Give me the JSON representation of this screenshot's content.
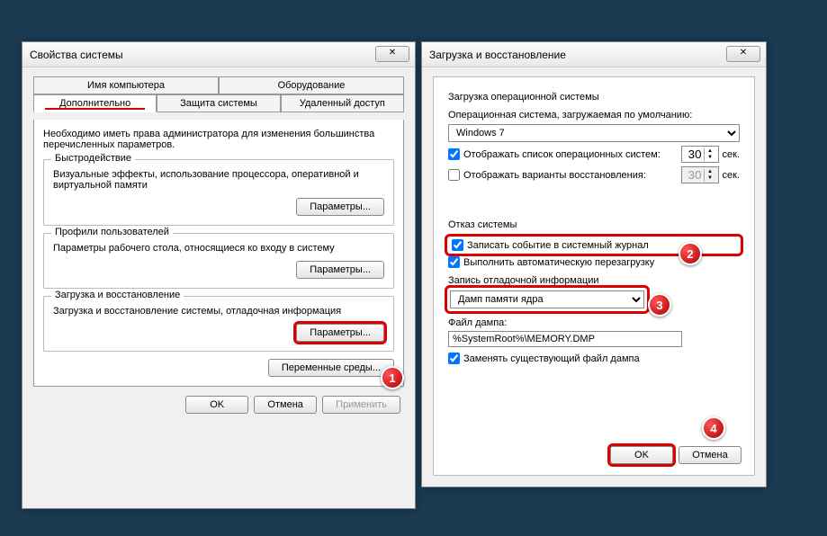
{
  "left": {
    "title": "Свойства системы",
    "tabs_row1": [
      "Имя компьютера",
      "Оборудование"
    ],
    "tabs_row2": [
      "Дополнительно",
      "Защита системы",
      "Удаленный доступ"
    ],
    "intro": "Необходимо иметь права администратора для изменения большинства перечисленных параметров.",
    "group1": {
      "title": "Быстродействие",
      "text": "Визуальные эффекты, использование процессора, оперативной и виртуальной памяти",
      "button": "Параметры..."
    },
    "group2": {
      "title": "Профили пользователей",
      "text": "Параметры рабочего стола, относящиеся ко входу в систему",
      "button": "Параметры..."
    },
    "group3": {
      "title": "Загрузка и восстановление",
      "text": "Загрузка и восстановление системы, отладочная информация",
      "button": "Параметры..."
    },
    "env_button": "Переменные среды...",
    "ok": "OK",
    "cancel": "Отмена",
    "apply": "Применить"
  },
  "right": {
    "title": "Загрузка и восстановление",
    "boot_section": "Загрузка операционной системы",
    "default_os_label": "Операционная система, загружаемая по умолчанию:",
    "default_os_value": "Windows 7",
    "show_os_list": "Отображать список операционных систем:",
    "show_os_time": "30",
    "show_recovery": "Отображать варианты восстановления:",
    "show_recovery_time": "30",
    "sec": "сек.",
    "failure_section": "Отказ системы",
    "log_event": "Записать событие в системный журнал",
    "auto_restart": "Выполнить автоматическую перезагрузку",
    "debug_label": "Запись отладочной информации",
    "dump_type": "Дамп памяти ядра",
    "dump_file_label": "Файл дампа:",
    "dump_file": "%SystemRoot%\\MEMORY.DMP",
    "overwrite": "Заменять существующий файл дампа",
    "ok": "OK",
    "cancel": "Отмена"
  },
  "markers": {
    "m1": "1",
    "m2": "2",
    "m3": "3",
    "m4": "4"
  }
}
